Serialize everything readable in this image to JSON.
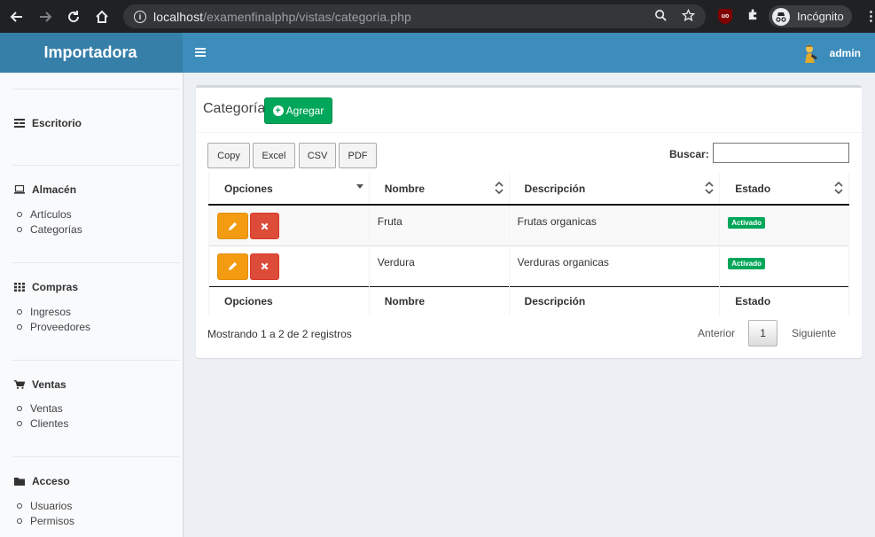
{
  "browser": {
    "url_host": "localhost",
    "url_path": "/examenfinalphp/vistas/categoria.php",
    "incognito_label": "Incógnito",
    "ext_label": "uo"
  },
  "app": {
    "logo": "Importadora",
    "user_name": "admin",
    "header_color": "#3c8dbc",
    "logo_color": "#367fa9"
  },
  "sidebar": {
    "sections": [
      {
        "label": "Escritorio",
        "icon": "dashboard-icon",
        "items": []
      },
      {
        "label": "Almacén",
        "icon": "laptop-icon",
        "items": [
          "Artículos",
          "Categorías"
        ]
      },
      {
        "label": "Compras",
        "icon": "grid-icon",
        "items": [
          "Ingresos",
          "Proveedores"
        ]
      },
      {
        "label": "Ventas",
        "icon": "cart-icon",
        "items": [
          "Ventas",
          "Clientes"
        ]
      },
      {
        "label": "Acceso",
        "icon": "folder-icon",
        "items": [
          "Usuarios",
          "Permisos"
        ]
      }
    ]
  },
  "main": {
    "title": "Categoría",
    "add_label": "Agregar",
    "export_buttons": [
      "Copy",
      "Excel",
      "CSV",
      "PDF"
    ],
    "search_label": "Buscar:",
    "search_value": "",
    "columns": [
      "Opciones",
      "Nombre",
      "Descripción",
      "Estado"
    ],
    "rows": [
      {
        "nombre": "Fruta",
        "descripcion": "Frutas organicas",
        "estado": "Activado"
      },
      {
        "nombre": "Verdura",
        "descripcion": "Verduras organicas",
        "estado": "Activado"
      }
    ],
    "info": "Mostrando 1 a 2 de 2 registros",
    "pagination": {
      "prev": "Anterior",
      "page": "1",
      "next": "Siguiente"
    }
  }
}
